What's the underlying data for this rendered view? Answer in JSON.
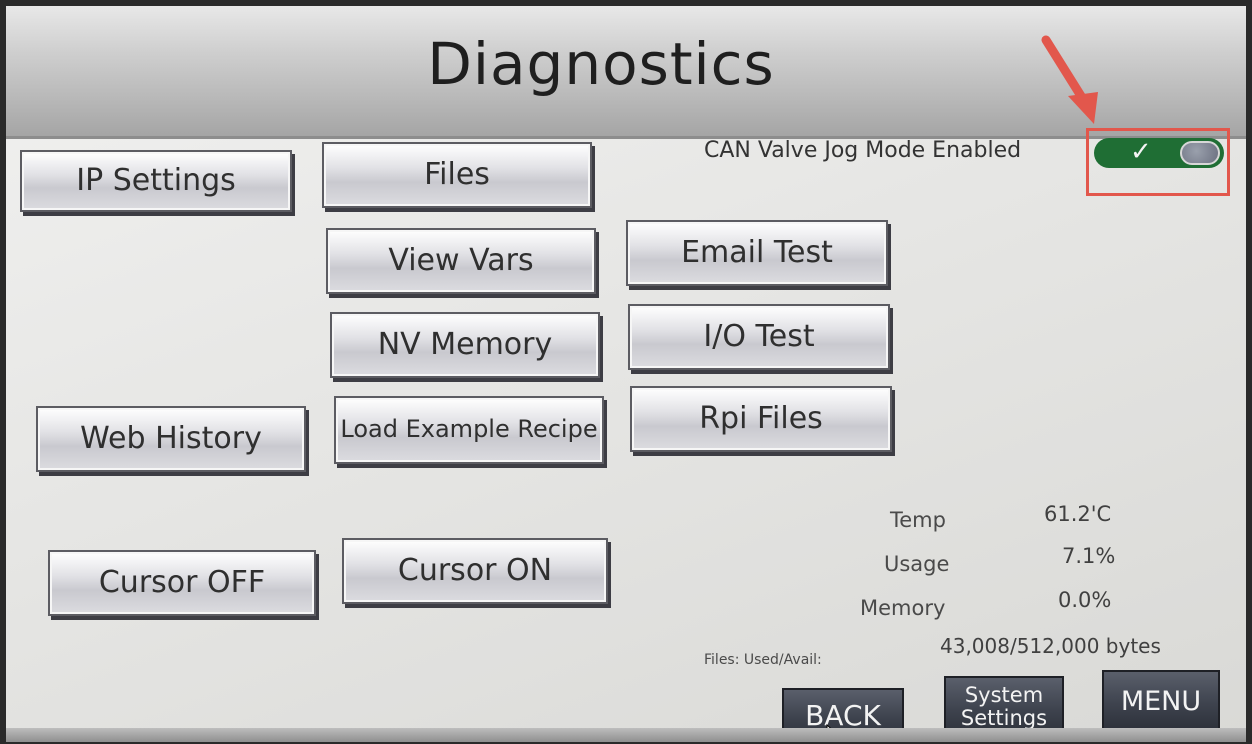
{
  "header": {
    "title": "Diagnostics"
  },
  "toggle": {
    "label": "CAN Valve Jog Mode Enabled",
    "enabled": true,
    "check_icon": "check-icon",
    "highlight_color": "#e2574c",
    "on_color": "#1f6e34"
  },
  "buttons": {
    "ip_settings": "IP Settings",
    "files": "Files",
    "view_vars": "View Vars",
    "email_test": "Email Test",
    "nv_memory": "NV Memory",
    "io_test": "I/O Test",
    "web_history": "Web History",
    "load_example_recipe": "Load Example Recipe",
    "rpi_files": "Rpi Files",
    "cursor_off": "Cursor OFF",
    "cursor_on": "Cursor ON"
  },
  "stats": {
    "temp_label": "Temp",
    "temp_value": "61.2'C",
    "usage_label": "Usage",
    "usage_value": "7.1%",
    "memory_label": "Memory",
    "memory_value": "0.0%",
    "files_label": "Files: Used/Avail:",
    "files_value": "43,008/512,000 bytes"
  },
  "nav": {
    "back": "BACK",
    "system_settings": "System Settings",
    "menu": "MENU"
  }
}
